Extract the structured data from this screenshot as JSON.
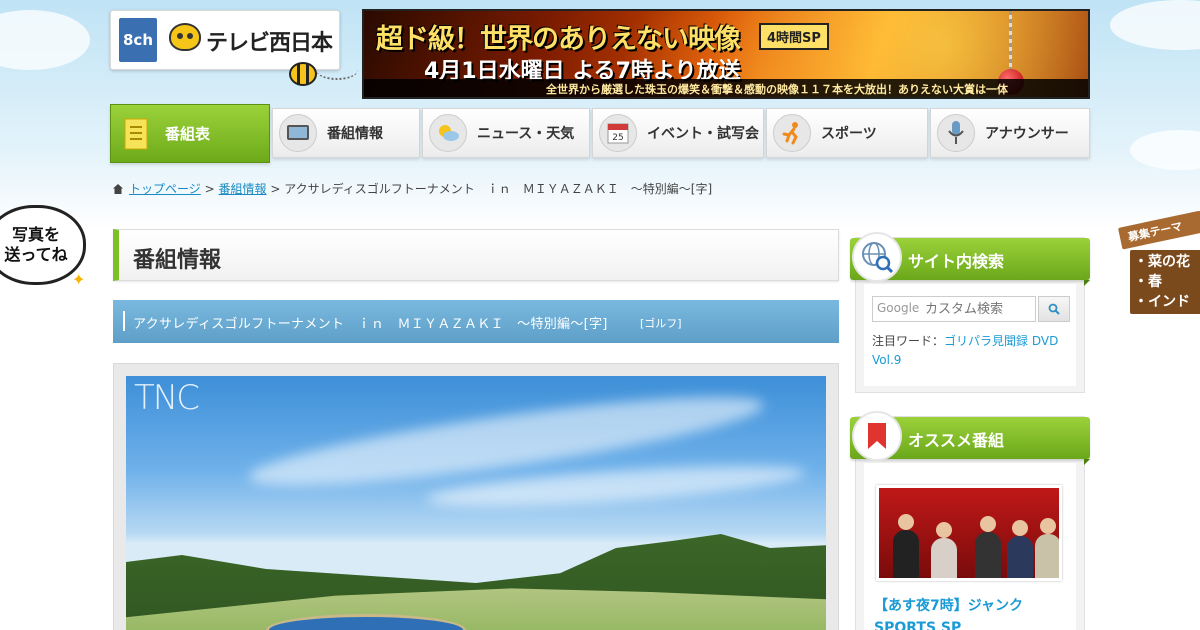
{
  "logo": {
    "channel": "8ch",
    "name": "テレビ西日本"
  },
  "banner": {
    "title": "超ド級！世界のありえない映像",
    "badge": "4時間SP",
    "date": "4月1日水曜日 よる7時より放送",
    "subtitle": "全世界から厳選した珠玉の爆笑＆衝撃＆感動の映像１１７本を大放出！ありえない大賞は一体"
  },
  "nav": {
    "items": [
      {
        "label": "番組表",
        "icon": "document-icon",
        "active": true
      },
      {
        "label": "番組情報",
        "icon": "tv-icon",
        "active": false
      },
      {
        "label": "ニュース・天気",
        "icon": "weather-icon",
        "active": false
      },
      {
        "label": "イベント・試写会",
        "icon": "calendar-icon",
        "active": false,
        "icon_text": "25"
      },
      {
        "label": "スポーツ",
        "icon": "runner-icon",
        "active": false
      },
      {
        "label": "アナウンサー",
        "icon": "microphone-icon",
        "active": false
      }
    ]
  },
  "bubble": {
    "line1": "写真を",
    "line2": "送ってね"
  },
  "theme_tab": {
    "title": "募集テーマ",
    "items": [
      "・菜の花",
      "・春",
      "・インド"
    ]
  },
  "breadcrumb": {
    "home": "トップページ",
    "sep": ">",
    "section": "番組情報",
    "current": "アクサレディスゴルフトーナメント　ｉｎ　ＭＩＹＡＺＡＫＩ　～特別編～[字]"
  },
  "main": {
    "page_title": "番組情報",
    "program_title": "アクサレディスゴルフトーナメント　ｉｎ　ＭＩＹＡＺＡＫＩ　～特別編～[字]",
    "program_genre": "[ゴルフ]",
    "photo_watermark": "TNC"
  },
  "sidebar": {
    "search": {
      "title": "サイト内検索",
      "google_mark": "Google",
      "placeholder": "カスタム検索",
      "keyword_label": "注目ワード：",
      "keyword_link": "ゴリパラ見聞録 DVD Vol.9"
    },
    "recommend": {
      "title": "オススメ番組",
      "program_title": "【あす夜7時】ジャンクSPORTS SP"
    }
  },
  "colors": {
    "accent_green": "#7cbf26",
    "link_blue": "#1a9bd7",
    "program_bar": "#6aa9d3"
  }
}
